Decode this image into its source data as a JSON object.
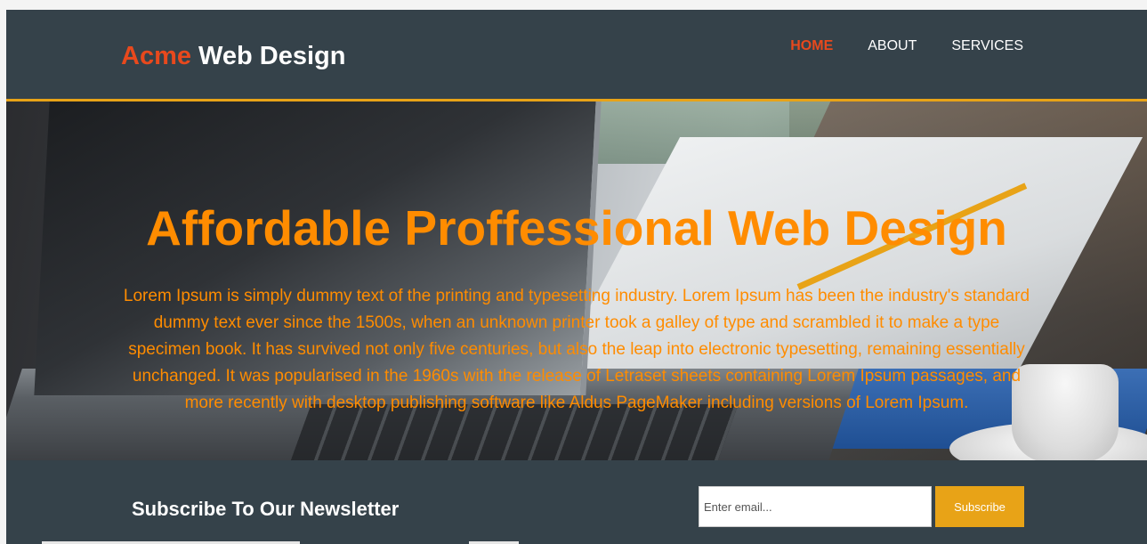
{
  "branding": {
    "highlight": "Acme",
    "rest": " Web Design"
  },
  "nav": {
    "items": [
      {
        "label": "HOME",
        "current": true
      },
      {
        "label": "ABOUT",
        "current": false
      },
      {
        "label": "SERVICES",
        "current": false
      }
    ]
  },
  "showcase": {
    "title": "Affordable Proffessional Web Design",
    "text": "Lorem Ipsum is simply dummy text of the printing and typesetting industry. Lorem Ipsum has been the industry's standard dummy text ever since the 1500s, when an unknown printer took a galley of type and scrambled it to make a type specimen book. It has survived not only five centuries, but also the leap into electronic typesetting, remaining essentially unchanged. It was popularised in the 1960s with the release of Letraset sheets containing Lorem Ipsum passages, and more recently with desktop publishing software like Aldus PageMaker including versions of Lorem Ipsum."
  },
  "newsletter": {
    "title": "Subscribe To Our Newsletter",
    "email_placeholder": "Enter email...",
    "email_value": "",
    "button_label": "Subscribe"
  },
  "colors": {
    "header_bg": "#35424a",
    "accent_orange": "#e8a317",
    "brand_highlight": "#e8491d",
    "showcase_text": "#ff8c00"
  }
}
